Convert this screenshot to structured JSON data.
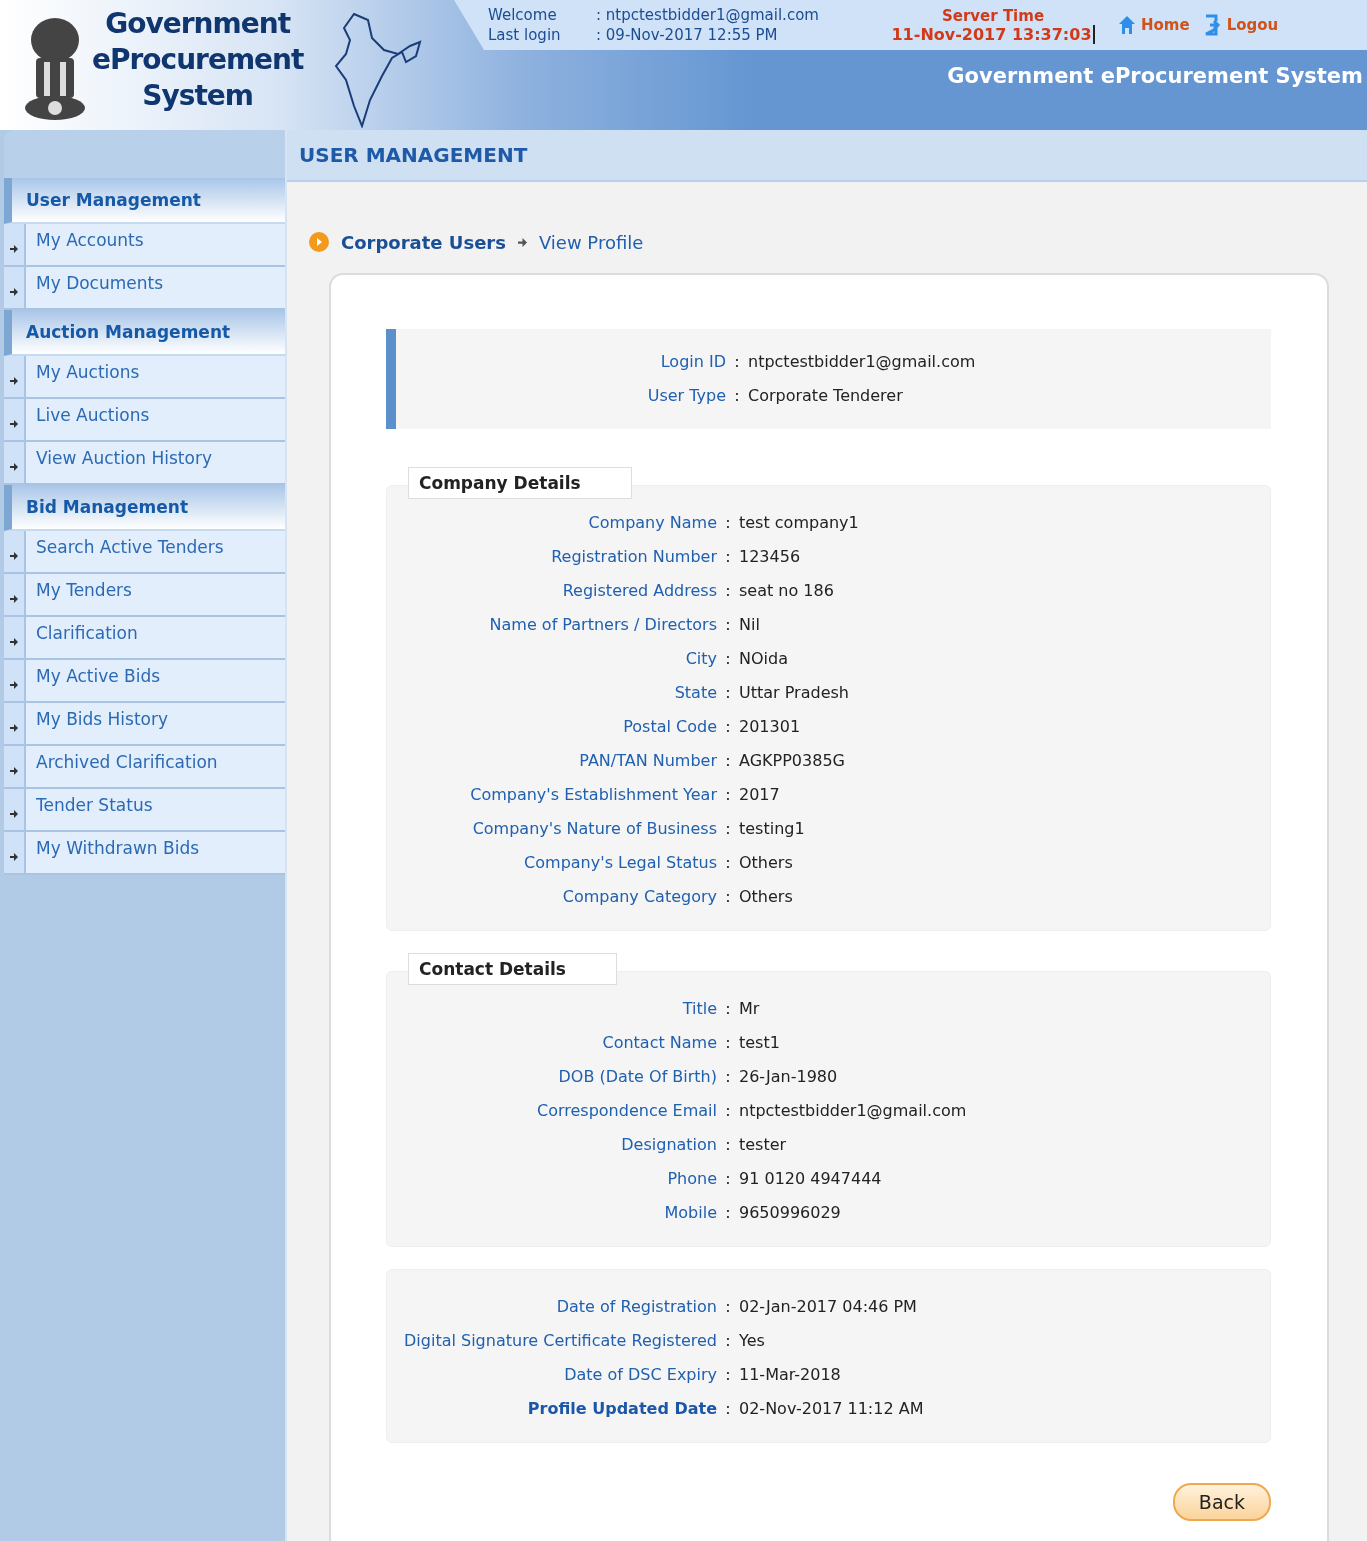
{
  "header": {
    "logo_lines": [
      "Government",
      "eProcurement",
      "System"
    ],
    "welcome_label": "Welcome",
    "welcome_value": ": ntpctestbidder1@gmail.com",
    "last_login_label": "Last login",
    "last_login_value": ": 09-Nov-2017 12:55 PM",
    "server_time_label": "Server Time",
    "server_time": "11-Nov-2017 13:37:03",
    "links": [
      {
        "label": "Home",
        "kind": "home"
      },
      {
        "label": "Logou",
        "kind": "logout"
      }
    ],
    "system_title": "Government eProcurement System"
  },
  "sidebar": {
    "groups": [
      {
        "title": "User Management",
        "items": [
          "My Accounts",
          "My Documents"
        ]
      },
      {
        "title": "Auction Management",
        "items": [
          "My Auctions",
          "Live Auctions",
          "View Auction History"
        ]
      },
      {
        "title": "Bid Management",
        "items": [
          "Search Active Tenders",
          "My Tenders",
          "Clarification",
          "My Active Bids",
          "My Bids History",
          "Archived Clarification",
          "Tender Status",
          "My Withdrawn Bids"
        ]
      }
    ]
  },
  "page_title": "USER MANAGEMENT",
  "breadcrumb": [
    "Corporate Users",
    "View Profile"
  ],
  "login_box": [
    {
      "label": "Login ID",
      "sep": ":",
      "value": "ntpctestbidder1@gmail.com"
    },
    {
      "label": "User Type",
      "sep": ":",
      "value": "Corporate Tenderer"
    }
  ],
  "sections": [
    {
      "title": "Company Details",
      "rows": [
        {
          "label": "Company Name",
          "sep": ":",
          "value": "test company1",
          "bold": false
        },
        {
          "label": "Registration Number",
          "sep": ":",
          "value": "123456",
          "bold": false
        },
        {
          "label": "Registered Address",
          "sep": ":",
          "value": "seat no 186",
          "bold": false
        },
        {
          "label": "Name of Partners / Directors",
          "sep": ":",
          "value": "Nil",
          "bold": false
        },
        {
          "label": "City",
          "sep": ":",
          "value": "NOida",
          "bold": false
        },
        {
          "label": "State",
          "sep": ":",
          "value": "Uttar Pradesh",
          "bold": false
        },
        {
          "label": "Postal Code",
          "sep": ":",
          "value": "201301",
          "bold": false
        },
        {
          "label": "PAN/TAN Number",
          "sep": ":",
          "value": "AGKPP0385G",
          "bold": false
        },
        {
          "label": "Company's Establishment Year",
          "sep": ":",
          "value": "2017",
          "bold": false
        },
        {
          "label": "Company's Nature of Business",
          "sep": ":",
          "value": "testing1",
          "bold": false
        },
        {
          "label": "Company's Legal Status",
          "sep": ":",
          "value": "Others",
          "bold": false
        },
        {
          "label": "Company Category",
          "sep": ":",
          "value": "Others",
          "bold": false
        }
      ]
    },
    {
      "title": "Contact Details",
      "rows": [
        {
          "label": "Title",
          "sep": ":",
          "value": "Mr",
          "bold": false
        },
        {
          "label": "Contact Name",
          "sep": ":",
          "value": "test1",
          "bold": false
        },
        {
          "label": "DOB (Date Of Birth)",
          "sep": ":",
          "value": "26-Jan-1980",
          "bold": false
        },
        {
          "label": "Correspondence Email",
          "sep": ":",
          "value": "ntpctestbidder1@gmail.com",
          "bold": false
        },
        {
          "label": "Designation",
          "sep": ":",
          "value": "tester",
          "bold": false
        },
        {
          "label": "Phone",
          "sep": ":",
          "value": "91  0120  4947444",
          "bold": false
        },
        {
          "label": "Mobile",
          "sep": ":",
          "value": "9650996029",
          "bold": false
        }
      ]
    },
    {
      "rows": [
        {
          "label": "Date of Registration",
          "sep": ":",
          "value": "02-Jan-2017 04:46 PM",
          "bold": false
        },
        {
          "label": "Digital Signature Certificate Registered",
          "sep": ":",
          "value": "Yes",
          "bold": false
        },
        {
          "label": "Date of DSC Expiry",
          "sep": ":",
          "value": "11-Mar-2018",
          "bold": false
        },
        {
          "label": "Profile Updated Date",
          "sep": ":",
          "value": "02-Nov-2017 11:12 AM",
          "bold": true
        }
      ]
    }
  ],
  "back_button": "Back"
}
